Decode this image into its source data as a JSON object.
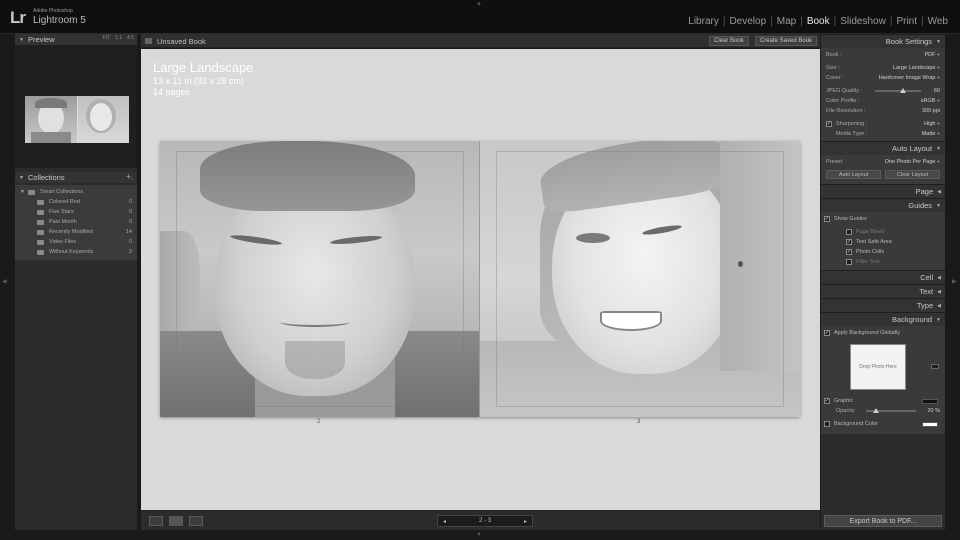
{
  "app": {
    "logo": "Lr",
    "vendor": "Adobe Photoshop",
    "name": "Lightroom 5"
  },
  "modules": [
    "Library",
    "Develop",
    "Map",
    "Book",
    "Slideshow",
    "Print",
    "Web"
  ],
  "active_module": "Book",
  "left_panel": {
    "preview_header": "Preview",
    "preview_zoom": [
      "FIT",
      "1:1",
      "4:1"
    ],
    "collections_header": "Collections",
    "collections_add": "+.",
    "smart_collections": "Smart Collections",
    "items": [
      {
        "label": "Colored Red",
        "count": "0"
      },
      {
        "label": "Five Stars",
        "count": "0"
      },
      {
        "label": "Past Month",
        "count": "0"
      },
      {
        "label": "Recently Modified",
        "count": "14"
      },
      {
        "label": "Video Files",
        "count": "0"
      },
      {
        "label": "Without Keywords",
        "count": "2"
      }
    ]
  },
  "toolbar": {
    "title": "Unsaved Book",
    "clear_label": "Clear Book",
    "save_label": "Create Saved Book"
  },
  "canvas": {
    "size_title": "Large Landscape",
    "size_dims": "13 x 11 in (33 x 28 cm)",
    "page_count": "14 pages",
    "page_left": "2",
    "page_right": "3"
  },
  "bottom": {
    "nav_prev": "◂",
    "nav_text": "2 - 3",
    "nav_next": "▸"
  },
  "right_panel": {
    "book_settings_header": "Book Settings",
    "book_label": "Book :",
    "book_value": "PDF ÷",
    "size_label": "Size :",
    "size_value": "Large Landscape ÷",
    "cover_label": "Cover :",
    "cover_value": "Hardcover Image Wrap ÷",
    "jpeg_label": "JPEG Quality :",
    "jpeg_value": "60",
    "jpeg_fraction": 0.6,
    "color_profile_label": "Color Profile :",
    "color_profile_value": "sRGB ÷",
    "file_res_label": "File Resolution :",
    "file_res_value": "300 ppi",
    "sharpening_label": "Sharpening :",
    "sharpening_value": "High ÷",
    "media_type_label": "Media Type :",
    "media_type_value": "Matte ÷",
    "auto_layout_header": "Auto Layout",
    "preset_label": "Preset:",
    "preset_value": "One Photo Per Page ÷",
    "auto_layout_btn": "Auto Layout",
    "clear_layout_btn": "Clear Layout",
    "page_header": "Page",
    "guides_header": "Guides",
    "show_guides": "Show Guides",
    "guide_items": [
      {
        "label": "Page Bleed",
        "checked": false
      },
      {
        "label": "Text Safe Area",
        "checked": true
      },
      {
        "label": "Photo Cells",
        "checked": true
      },
      {
        "label": "Filler Text",
        "checked": false
      }
    ],
    "cell_header": "Cell",
    "text_header": "Text",
    "type_header": "Type",
    "background_header": "Background",
    "apply_bg": "Apply Background Globally",
    "drop_photo": "Drop Photo Here",
    "graphic_label": "Graphic",
    "opacity_label": "Opacity",
    "opacity_value": "20",
    "opacity_unit": "%",
    "opacity_fraction": 0.2,
    "bg_color_label": "Background Color",
    "export_label": "Export Book to PDF..."
  },
  "colors": {
    "panel": "#2b2b2b",
    "canvas": "#d9d9d9",
    "active_module": "#e8e8e8"
  }
}
